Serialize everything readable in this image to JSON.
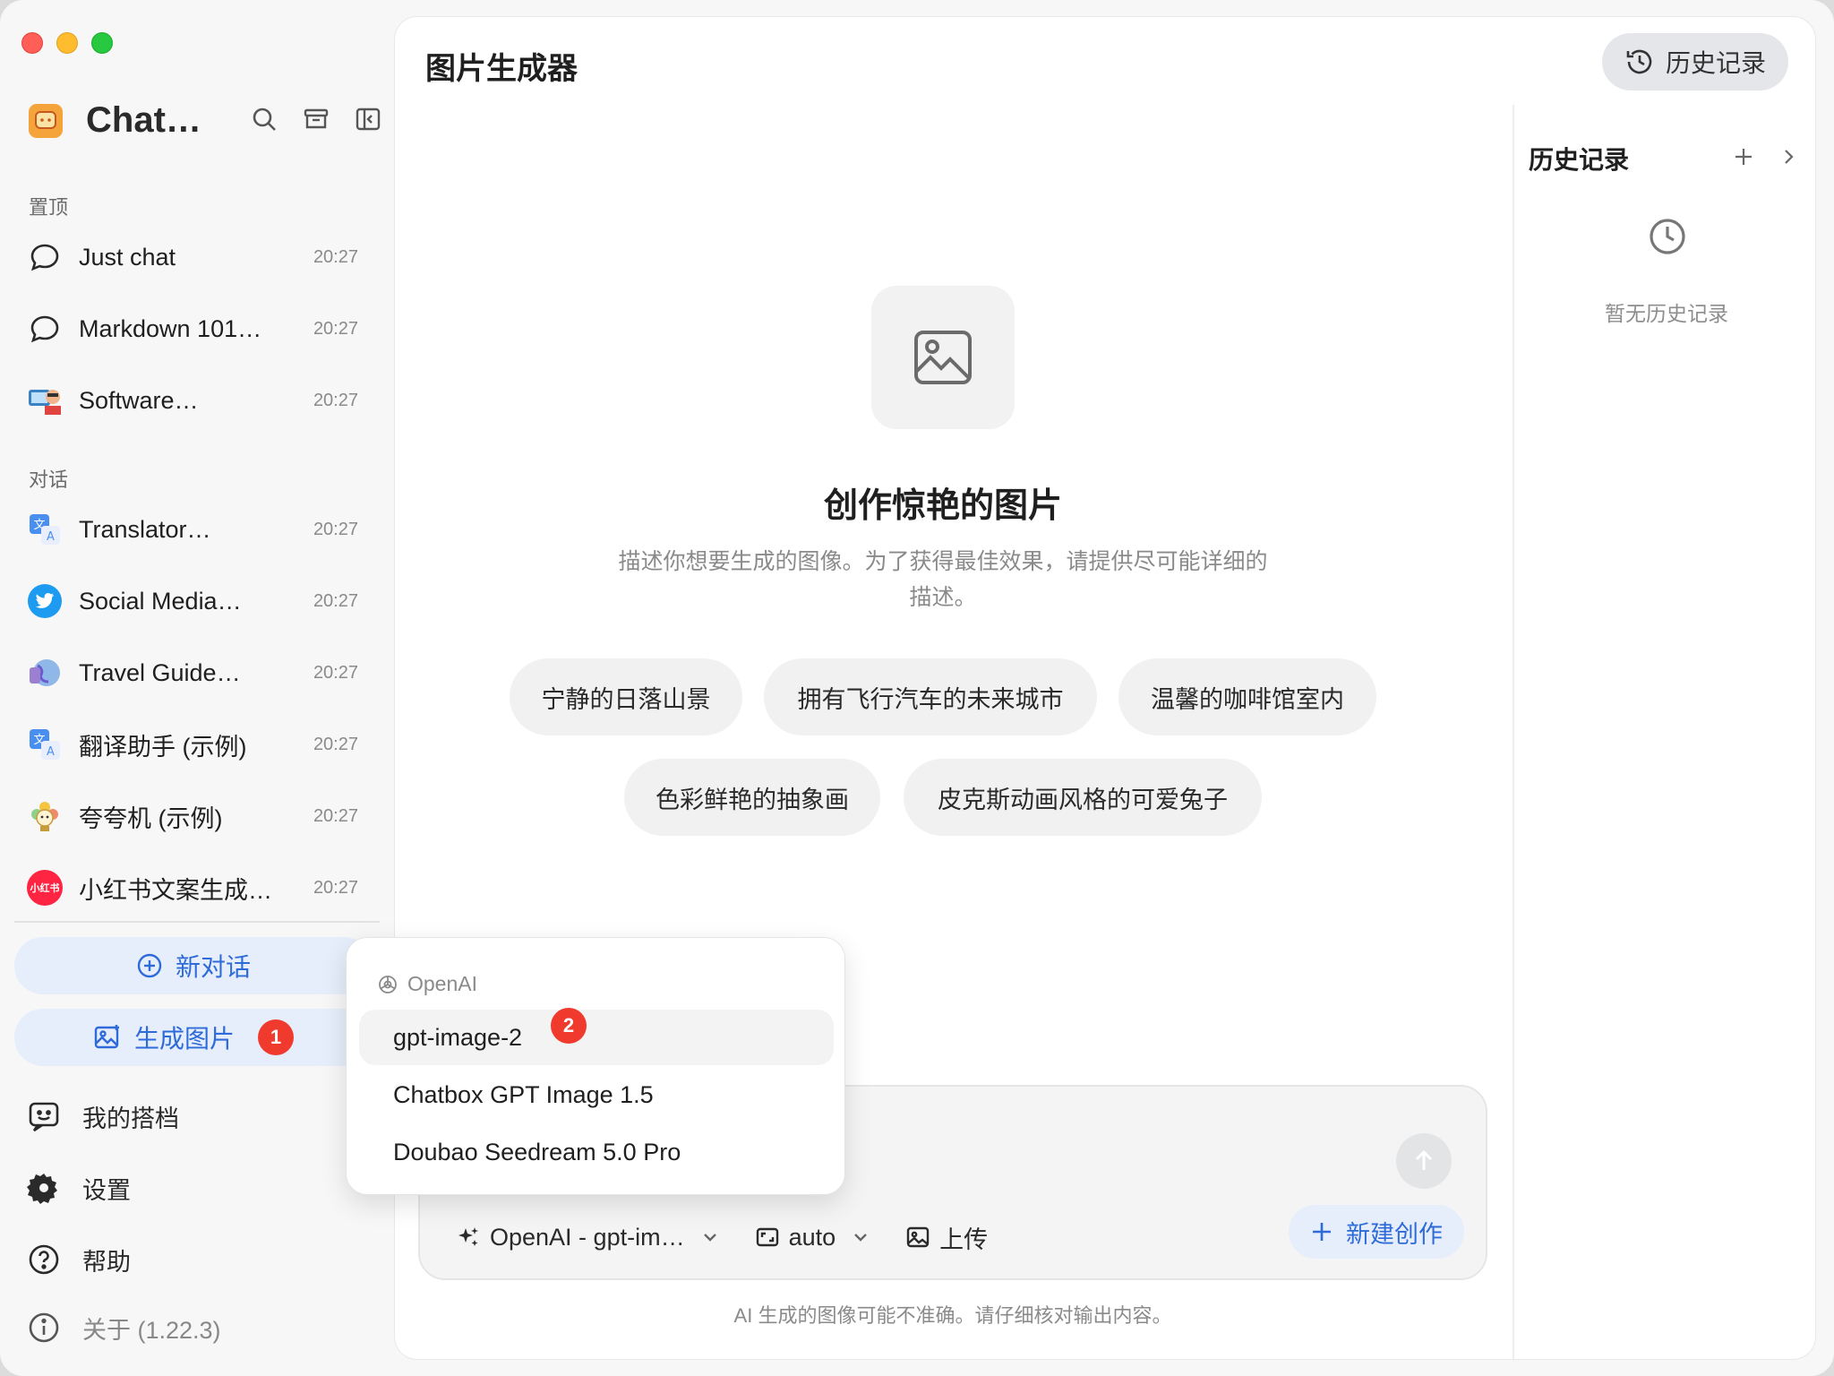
{
  "window": {
    "traffic_lights": [
      "close",
      "minimize",
      "zoom"
    ]
  },
  "sidebar": {
    "app_title": "Chat…",
    "pinned_label": "置顶",
    "pinned": [
      {
        "title": "Just chat",
        "time": "20:27",
        "icon": "chat-bubble-icon"
      },
      {
        "title": "Markdown 101…",
        "time": "20:27",
        "icon": "chat-bubble-icon"
      },
      {
        "title": "Software…",
        "time": "20:27",
        "icon": "developer-avatar-icon"
      }
    ],
    "conversations_label": "对话",
    "conversations": [
      {
        "title": "Translator…",
        "time": "20:27",
        "icon": "translate-icon"
      },
      {
        "title": "Social Media…",
        "time": "20:27",
        "icon": "twitter-bird-icon"
      },
      {
        "title": "Travel Guide…",
        "time": "20:27",
        "icon": "globe-icon"
      },
      {
        "title": "翻译助手 (示例)",
        "time": "20:27",
        "icon": "translate-icon"
      },
      {
        "title": "夸夸机 (示例)",
        "time": "20:27",
        "icon": "flower-icon"
      },
      {
        "title": "小红书文案生成…",
        "time": "20:27",
        "icon": "xiaohongshu-icon",
        "icon_text": "小红书"
      }
    ],
    "new_chat_label": "新对话",
    "generate_image_label": "生成图片",
    "generate_image_badge": "1",
    "bottom": [
      {
        "label": "我的搭档"
      },
      {
        "label": "设置"
      },
      {
        "label": "帮助"
      },
      {
        "label": "关于 (1.22.3)"
      }
    ]
  },
  "main": {
    "title": "图片生成器",
    "history_button": "历史记录",
    "hero_title": "创作惊艳的图片",
    "hero_subtitle_line1": "描述你想要生成的图像。为了获得最佳效果，请提供尽可能详细的",
    "hero_subtitle_line2": "描述。",
    "suggestions": [
      "宁静的日落山景",
      "拥有飞行汽车的未来城市",
      "温馨的咖啡馆室内",
      "色彩鲜艳的抽象画",
      "皮克斯动画风格的可爱兔子"
    ],
    "model_selector": "OpenAI - gpt-im…",
    "ratio_selector": "auto",
    "upload_label": "上传",
    "new_create_label": "新建创作",
    "disclaimer": "AI 生成的图像可能不准确。请仔细核对输出内容。"
  },
  "history_panel": {
    "title": "历史记录",
    "empty_text": "暂无历史记录"
  },
  "dropdown": {
    "group": "OpenAI",
    "items": [
      "gpt-image-2",
      "Chatbox GPT Image 1.5",
      "Doubao Seedream 5.0 Pro"
    ],
    "active_badge": "2"
  },
  "colors": {
    "accent": "#2e6bd8",
    "badge": "#f03a2e",
    "accent_bg": "#e6eefb"
  }
}
